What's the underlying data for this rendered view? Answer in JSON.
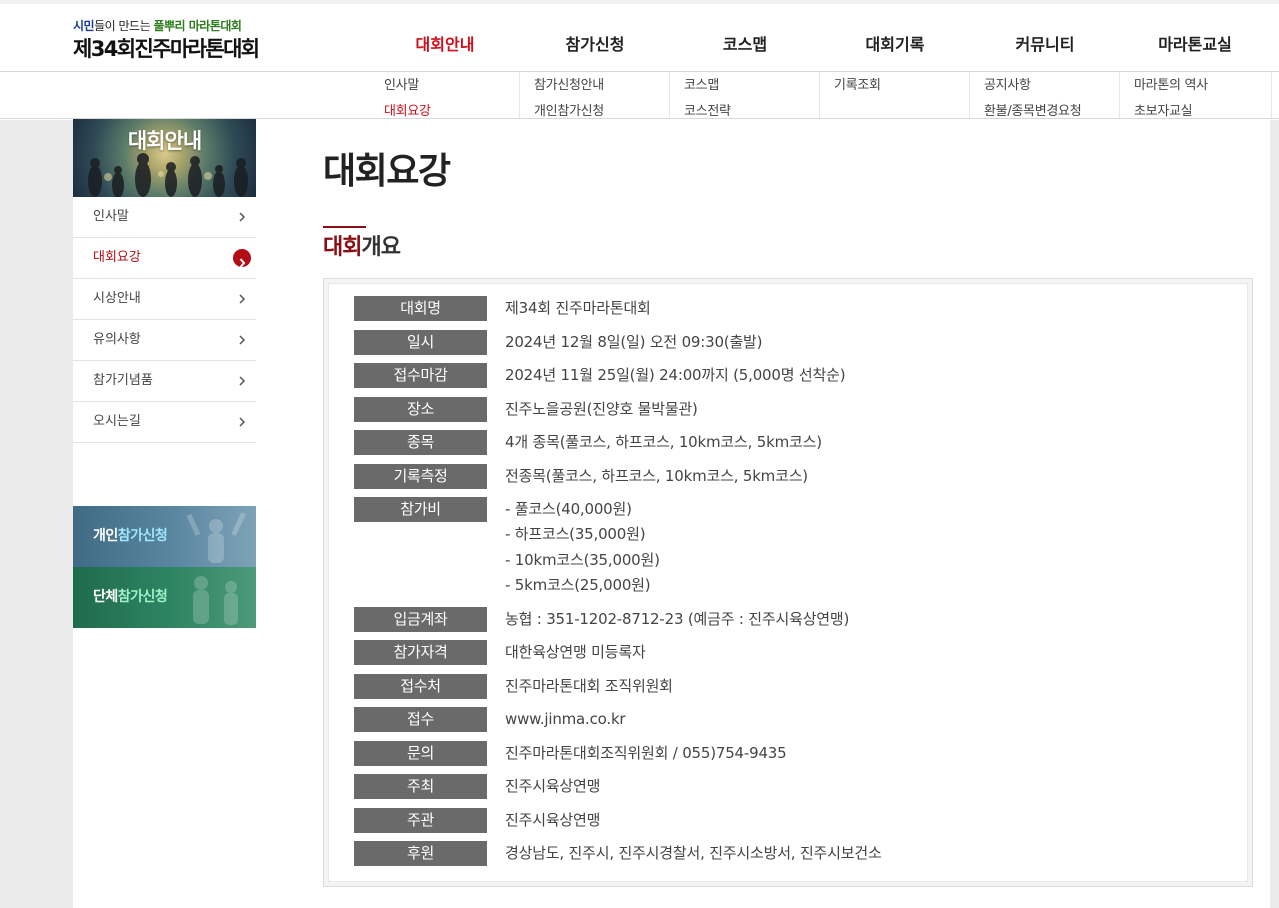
{
  "logo": {
    "tagline_a": "시민",
    "tagline_b": "들이 만드는 ",
    "tagline_c": "풀뿌리 마라톤대회",
    "title": "제34회진주마라톤대회"
  },
  "gnb": {
    "items": [
      {
        "label": "대회안내",
        "active": true
      },
      {
        "label": "참가신청"
      },
      {
        "label": "코스맵"
      },
      {
        "label": "대회기록"
      },
      {
        "label": "커뮤니티"
      },
      {
        "label": "마라톤교실"
      }
    ]
  },
  "submenu": {
    "cols": [
      [
        "인사말",
        "대회요강"
      ],
      [
        "참가신청안내",
        "개인참가신청"
      ],
      [
        "코스맵",
        "코스전략"
      ],
      [
        "기록조회"
      ],
      [
        "공지사항",
        "환불/종목변경요청"
      ],
      [
        "마라톤의 역사",
        "초보자교실"
      ]
    ],
    "active": "대회요강"
  },
  "sidebar": {
    "banner_title": "대회안내",
    "items": [
      {
        "label": "인사말"
      },
      {
        "label": "대회요강",
        "active": true
      },
      {
        "label": "시상안내"
      },
      {
        "label": "유의사항"
      },
      {
        "label": "참가기념품"
      },
      {
        "label": "오시는길"
      }
    ],
    "individual": {
      "prefix": "개인",
      "accent": "참가신청"
    },
    "team": {
      "prefix": "단체",
      "accent": "참가신청"
    }
  },
  "main": {
    "page_title": "대회요강",
    "section_title_accent": "대회",
    "section_title_rest": "개요",
    "rows": [
      {
        "label": "대회명",
        "value": "제34회 진주마라톤대회"
      },
      {
        "label": "일시",
        "value": "2024년 12월 8일(일) 오전 09:30(출발)"
      },
      {
        "label": "접수마감",
        "value": "2024년 11월 25일(월) 24:00까지 (5,000명 선착순)"
      },
      {
        "label": "장소",
        "value": "진주노을공원(진양호 물박물관)"
      },
      {
        "label": "종목",
        "value": "4개 종목(풀코스, 하프코스, 10km코스, 5km코스)"
      },
      {
        "label": "기록측정",
        "value": "전종목(풀코스, 하프코스, 10km코스, 5km코스)"
      },
      {
        "label": "참가비",
        "lines": [
          "- 풀코스(40,000원)",
          "- 하프코스(35,000원)",
          "- 10km코스(35,000원)",
          "- 5km코스(25,000원)"
        ]
      },
      {
        "label": "입금계좌",
        "value": "농협 : 351-1202-8712-23 (예금주 : 진주시육상연맹)"
      },
      {
        "label": "참가자격",
        "value": "대한육상연맹 미등록자"
      },
      {
        "label": "접수처",
        "value": "진주마라톤대회 조직위원회"
      },
      {
        "label": "접수",
        "value": "www.jinma.co.kr"
      },
      {
        "label": "문의",
        "value": "진주마라톤대회조직위원회 / 055)754-9435"
      },
      {
        "label": "주최",
        "value": "진주시육상연맹"
      },
      {
        "label": "주관",
        "value": "진주시육상연맹"
      },
      {
        "label": "후원",
        "value": "경상남도, 진주시, 진주시경찰서, 진주시소방서, 진주시보건소"
      }
    ]
  },
  "colors": {
    "accent_red": "#d0101c",
    "section_red": "#8b0d14",
    "label_bg": "#6a6a6a"
  }
}
